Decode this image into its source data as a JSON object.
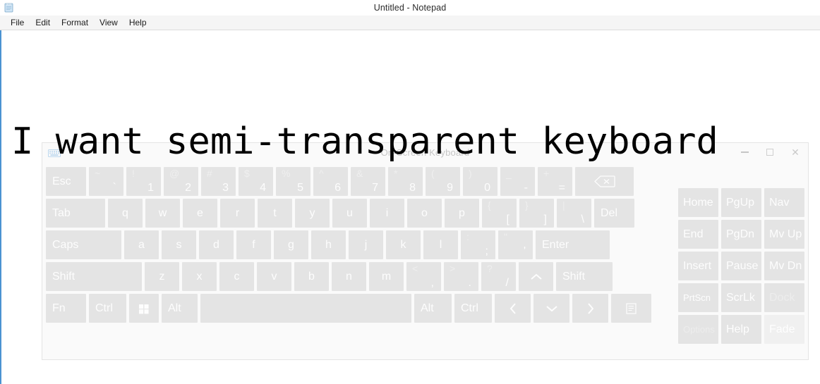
{
  "notepad": {
    "title": "Untitled - Notepad",
    "app_icon": "notepad-icon",
    "menu": [
      {
        "label": "File",
        "name": "menu-file"
      },
      {
        "label": "Edit",
        "name": "menu-edit"
      },
      {
        "label": "Format",
        "name": "menu-format"
      },
      {
        "label": "View",
        "name": "menu-view"
      },
      {
        "label": "Help",
        "name": "menu-help"
      }
    ],
    "document_text": "I want semi-transparent keyboard"
  },
  "osk": {
    "title": "On-Screen Keyboard",
    "icon": "keyboard-icon",
    "window_controls": {
      "minimize": "minimize-icon",
      "maximize": "maximize-icon",
      "close": "close-icon"
    },
    "rows": {
      "row1": [
        {
          "label": "Esc"
        },
        {
          "label": "`",
          "shifted": "~"
        },
        {
          "label": "1",
          "shifted": "!"
        },
        {
          "label": "2",
          "shifted": "@"
        },
        {
          "label": "3",
          "shifted": "#"
        },
        {
          "label": "4",
          "shifted": "$"
        },
        {
          "label": "5",
          "shifted": "%"
        },
        {
          "label": "6",
          "shifted": "^"
        },
        {
          "label": "7",
          "shifted": "&"
        },
        {
          "label": "8",
          "shifted": "*"
        },
        {
          "label": "9",
          "shifted": "("
        },
        {
          "label": "0",
          "shifted": ")"
        },
        {
          "label": "-",
          "shifted": "_"
        },
        {
          "label": "=",
          "shifted": "+"
        },
        {
          "label": "Backspace"
        }
      ],
      "row2": [
        {
          "label": "Tab"
        },
        {
          "label": "q"
        },
        {
          "label": "w"
        },
        {
          "label": "e"
        },
        {
          "label": "r"
        },
        {
          "label": "t"
        },
        {
          "label": "y"
        },
        {
          "label": "u"
        },
        {
          "label": "i"
        },
        {
          "label": "o"
        },
        {
          "label": "p"
        },
        {
          "label": "[",
          "shifted": "{"
        },
        {
          "label": "]",
          "shifted": "}"
        },
        {
          "label": "\\",
          "shifted": "|"
        },
        {
          "label": "Del"
        }
      ],
      "row3": [
        {
          "label": "Caps"
        },
        {
          "label": "a"
        },
        {
          "label": "s"
        },
        {
          "label": "d"
        },
        {
          "label": "f"
        },
        {
          "label": "g"
        },
        {
          "label": "h"
        },
        {
          "label": "j"
        },
        {
          "label": "k"
        },
        {
          "label": "l"
        },
        {
          "label": ";",
          "shifted": ":"
        },
        {
          "label": "'",
          "shifted": "\""
        },
        {
          "label": "Enter"
        }
      ],
      "row4": [
        {
          "label": "Shift"
        },
        {
          "label": "z"
        },
        {
          "label": "x"
        },
        {
          "label": "c"
        },
        {
          "label": "v"
        },
        {
          "label": "b"
        },
        {
          "label": "n"
        },
        {
          "label": "m"
        },
        {
          "label": ",",
          "shifted": "<"
        },
        {
          "label": ".",
          "shifted": ">"
        },
        {
          "label": "/",
          "shifted": "?"
        },
        {
          "label": "Up"
        },
        {
          "label": "Shift"
        }
      ],
      "row5": [
        {
          "label": "Fn"
        },
        {
          "label": "Ctrl"
        },
        {
          "label": "Win"
        },
        {
          "label": "Alt"
        },
        {
          "label": "Space"
        },
        {
          "label": "Alt"
        },
        {
          "label": "Ctrl"
        },
        {
          "label": "Left"
        },
        {
          "label": "Down"
        },
        {
          "label": "Right"
        },
        {
          "label": "Menu"
        }
      ]
    },
    "navpad": [
      [
        {
          "label": "Home"
        },
        {
          "label": "PgUp"
        },
        {
          "label": "Nav"
        }
      ],
      [
        {
          "label": "End"
        },
        {
          "label": "PgDn"
        },
        {
          "label": "Mv Up"
        }
      ],
      [
        {
          "label": "Insert"
        },
        {
          "label": "Pause"
        },
        {
          "label": "Mv Dn"
        }
      ],
      [
        {
          "label": "PrtScn"
        },
        {
          "label": "ScrLk"
        },
        {
          "label": "Dock"
        }
      ],
      [
        {
          "label": "Options"
        },
        {
          "label": "Help"
        },
        {
          "label": "Fade"
        }
      ]
    ]
  },
  "colors": {
    "accent": "#4b93d1",
    "key_face": "#d7d7d7",
    "panel": "#f9f9f9",
    "text": "#000000"
  }
}
